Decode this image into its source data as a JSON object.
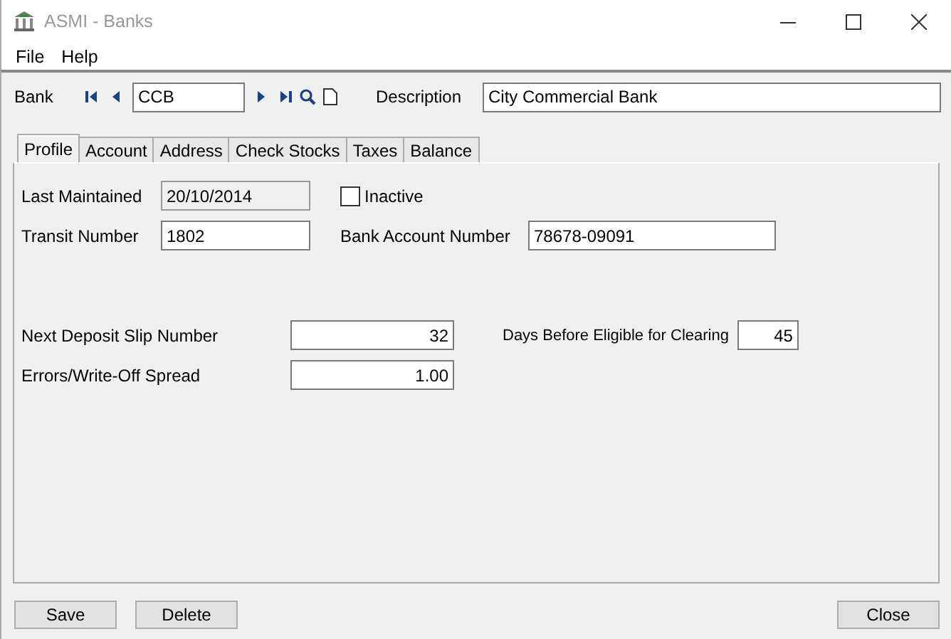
{
  "window": {
    "title": "ASMI - Banks"
  },
  "menu": [
    "File",
    "Help"
  ],
  "toolbar": {
    "bank_label": "Bank",
    "bank_code": "CCB",
    "description_label": "Description",
    "description": "City Commercial Bank"
  },
  "tabs": [
    {
      "label": "Profile",
      "selected": true
    },
    {
      "label": "Account",
      "selected": false
    },
    {
      "label": "Address",
      "selected": false
    },
    {
      "label": "Check Stocks",
      "selected": false
    },
    {
      "label": "Taxes",
      "selected": false
    },
    {
      "label": "Balance",
      "selected": false
    }
  ],
  "profile": {
    "last_maintained": {
      "label": "Last Maintained",
      "value": "20/10/2014",
      "disabled": true
    },
    "inactive": {
      "label": "Inactive",
      "checked": false
    },
    "transit_number": {
      "label": "Transit Number",
      "value": "1802"
    },
    "bank_account_number": {
      "label": "Bank Account Number",
      "value": "78678-09091"
    },
    "next_deposit_slip": {
      "label": "Next Deposit Slip Number",
      "value": "32"
    },
    "days_before_clearing": {
      "label": "Days Before Eligible for Clearing",
      "value": "45"
    },
    "errors_spread": {
      "label": "Errors/Write-Off Spread",
      "value": "1.00"
    }
  },
  "buttons": {
    "left": [
      "Save",
      "Delete"
    ],
    "right": [
      "Close"
    ]
  }
}
